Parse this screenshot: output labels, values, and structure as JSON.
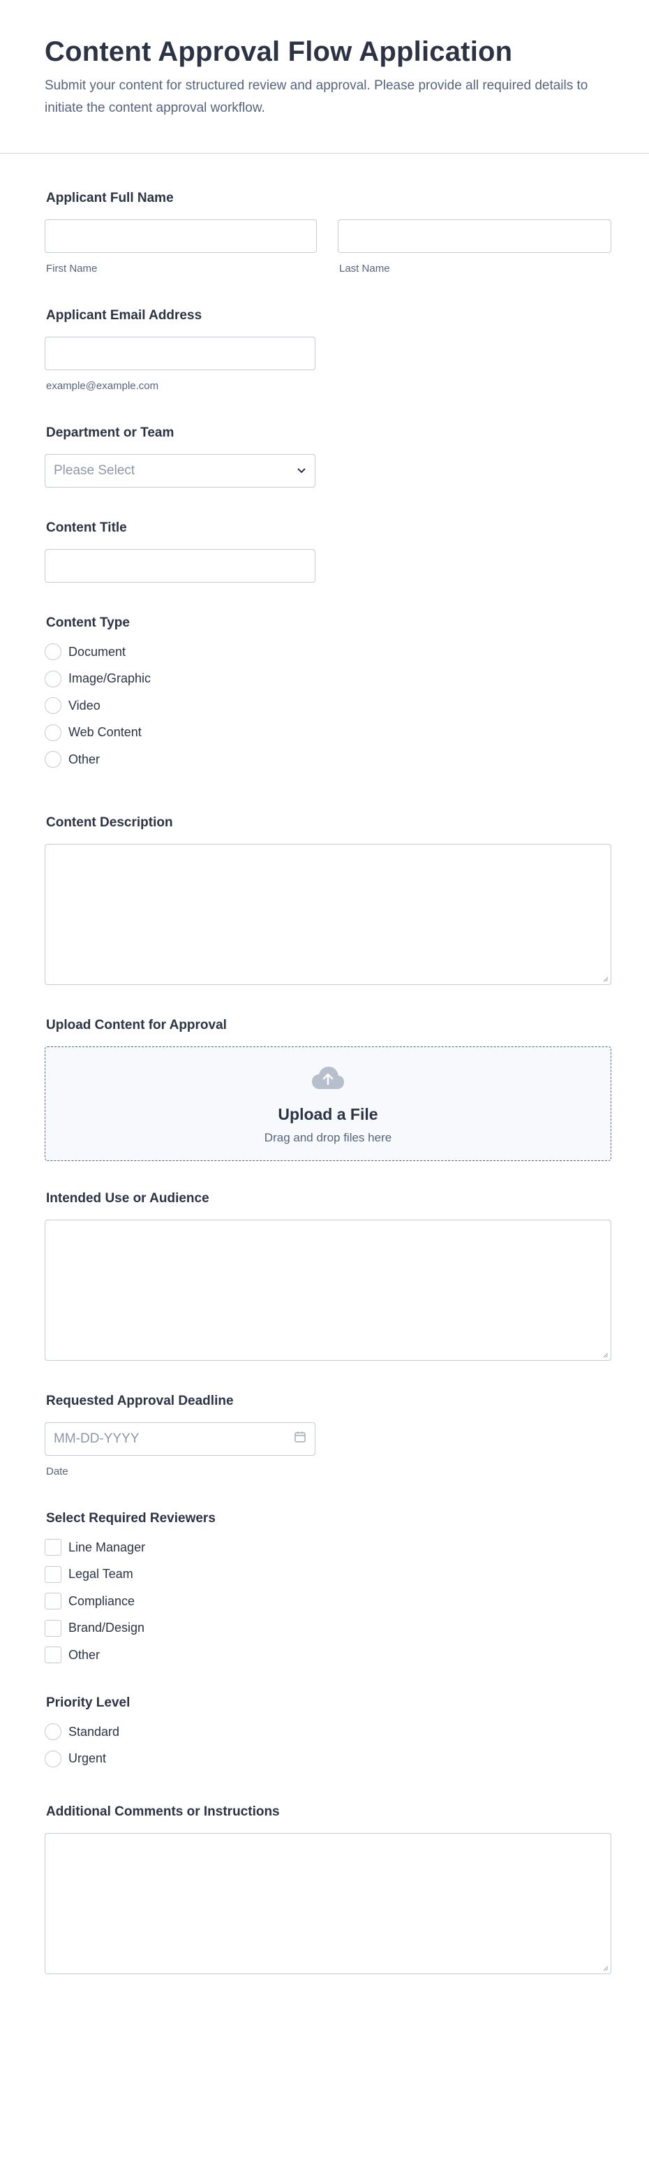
{
  "header": {
    "title": "Content Approval Flow Application",
    "description": "Submit your content for structured review and approval. Please provide all required details to initiate the content approval workflow."
  },
  "name": {
    "label": "Applicant Full Name",
    "first_sub": "First Name",
    "last_sub": "Last Name"
  },
  "email": {
    "label": "Applicant Email Address",
    "sub": "example@example.com"
  },
  "department": {
    "label": "Department or Team",
    "placeholder": "Please Select"
  },
  "content_title": {
    "label": "Content Title"
  },
  "content_type": {
    "label": "Content Type",
    "options": [
      "Document",
      "Image/Graphic",
      "Video",
      "Web Content",
      "Other"
    ]
  },
  "content_description": {
    "label": "Content Description"
  },
  "upload": {
    "label": "Upload Content for Approval",
    "title": "Upload a File",
    "subtitle": "Drag and drop files here",
    "icon": "cloud-upload-icon"
  },
  "intended_use": {
    "label": "Intended Use or Audience"
  },
  "deadline": {
    "label": "Requested Approval Deadline",
    "placeholder": "MM-DD-YYYY",
    "sub": "Date",
    "icon": "calendar-icon"
  },
  "reviewers": {
    "label": "Select Required Reviewers",
    "options": [
      "Line Manager",
      "Legal Team",
      "Compliance",
      "Brand/Design",
      "Other"
    ]
  },
  "priority": {
    "label": "Priority Level",
    "options": [
      "Standard",
      "Urgent"
    ]
  },
  "comments": {
    "label": "Additional Comments or Instructions"
  },
  "colors": {
    "text": "#2c3345",
    "muted": "#57647e",
    "border": "#c3cad8",
    "upload_bg": "#f8f9fc"
  }
}
